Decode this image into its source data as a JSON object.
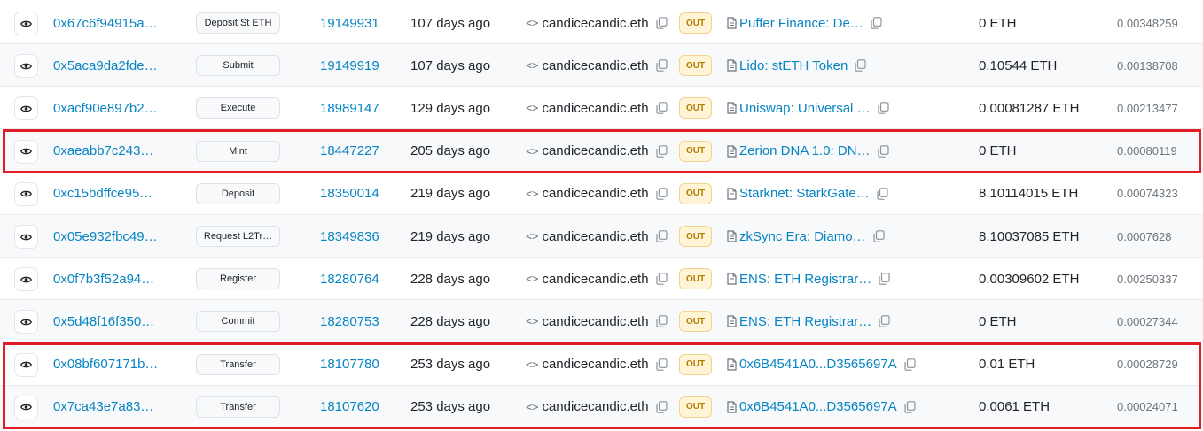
{
  "colors": {
    "link": "#0784c3",
    "highlight": "#e01e25",
    "out_badge_bg": "#fff4d6",
    "out_badge_text": "#b47d00"
  },
  "icons": {
    "details": "eye-icon",
    "contract": "code-icon",
    "copy": "copy-icon",
    "to_contract": "document-icon"
  },
  "transactions": [
    {
      "hash": "0x67c6f94915a…",
      "method": "Deposit St ETH",
      "block": "19149931",
      "age": "107 days ago",
      "from": "candicecandic.eth",
      "direction": "OUT",
      "to": "Puffer Finance: De…",
      "value": "0 ETH",
      "fee": "0.00348259"
    },
    {
      "hash": "0x5aca9da2fde…",
      "method": "Submit",
      "block": "19149919",
      "age": "107 days ago",
      "from": "candicecandic.eth",
      "direction": "OUT",
      "to": "Lido: stETH Token",
      "value": "0.10544 ETH",
      "fee": "0.00138708"
    },
    {
      "hash": "0xacf90e897b2…",
      "method": "Execute",
      "block": "18989147",
      "age": "129 days ago",
      "from": "candicecandic.eth",
      "direction": "OUT",
      "to": "Uniswap: Universal …",
      "value": "0.00081287 ETH",
      "fee": "0.00213477"
    },
    {
      "hash": "0xaeabb7c243…",
      "method": "Mint",
      "block": "18447227",
      "age": "205 days ago",
      "from": "candicecandic.eth",
      "direction": "OUT",
      "to": "Zerion DNA 1.0: DN…",
      "value": "0 ETH",
      "fee": "0.00080119"
    },
    {
      "hash": "0xc15bdffce95…",
      "method": "Deposit",
      "block": "18350014",
      "age": "219 days ago",
      "from": "candicecandic.eth",
      "direction": "OUT",
      "to": "Starknet: StarkGate…",
      "value": "8.10114015 ETH",
      "fee": "0.00074323"
    },
    {
      "hash": "0x05e932fbc49…",
      "method": "Request L2Tr…",
      "block": "18349836",
      "age": "219 days ago",
      "from": "candicecandic.eth",
      "direction": "OUT",
      "to": "zkSync Era: Diamo…",
      "value": "8.10037085 ETH",
      "fee": "0.0007628"
    },
    {
      "hash": "0x0f7b3f52a94…",
      "method": "Register",
      "block": "18280764",
      "age": "228 days ago",
      "from": "candicecandic.eth",
      "direction": "OUT",
      "to": "ENS: ETH Registrar…",
      "value": "0.00309602 ETH",
      "fee": "0.00250337"
    },
    {
      "hash": "0x5d48f16f350…",
      "method": "Commit",
      "block": "18280753",
      "age": "228 days ago",
      "from": "candicecandic.eth",
      "direction": "OUT",
      "to": "ENS: ETH Registrar…",
      "value": "0 ETH",
      "fee": "0.00027344"
    },
    {
      "hash": "0x08bf607171b…",
      "method": "Transfer",
      "block": "18107780",
      "age": "253 days ago",
      "from": "candicecandic.eth",
      "direction": "OUT",
      "to": "0x6B4541A0...D3565697A",
      "value": "0.01 ETH",
      "fee": "0.00028729"
    },
    {
      "hash": "0x7ca43e7a83…",
      "method": "Transfer",
      "block": "18107620",
      "age": "253 days ago",
      "from": "candicecandic.eth",
      "direction": "OUT",
      "to": "0x6B4541A0...D3565697A",
      "value": "0.0061 ETH",
      "fee": "0.00024071"
    }
  ]
}
